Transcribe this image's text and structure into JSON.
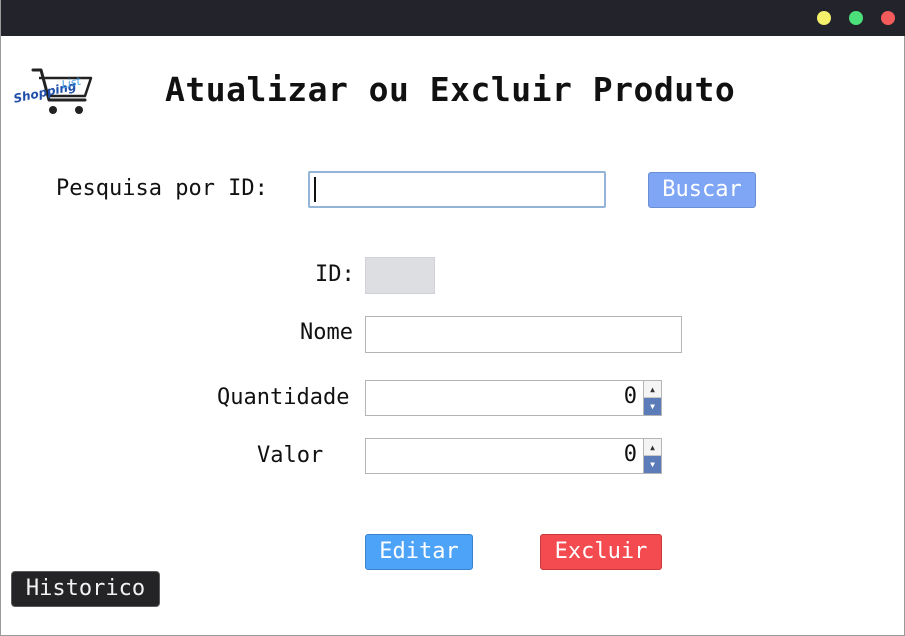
{
  "window": {
    "titlebar_color": "#22232b",
    "controls": [
      "minimize",
      "maximize",
      "close"
    ]
  },
  "header": {
    "logo_text": "ShoppingList",
    "title": "Atualizar ou Excluir Produto"
  },
  "search": {
    "label": "Pesquisa por ID:",
    "value": "",
    "button_label": "Buscar"
  },
  "form": {
    "id_label": "ID:",
    "id_value": "",
    "nome_label": "Nome",
    "nome_value": "",
    "quantidade_label": "Quantidade",
    "quantidade_value": "0",
    "valor_label": "Valor",
    "valor_value": "0"
  },
  "actions": {
    "editar_label": "Editar",
    "excluir_label": "Excluir",
    "historico_label": "Historico"
  },
  "colors": {
    "buscar": "#7ea6f5",
    "editar": "#4ca3f8",
    "excluir": "#f34b4f",
    "historico": "#242426"
  }
}
